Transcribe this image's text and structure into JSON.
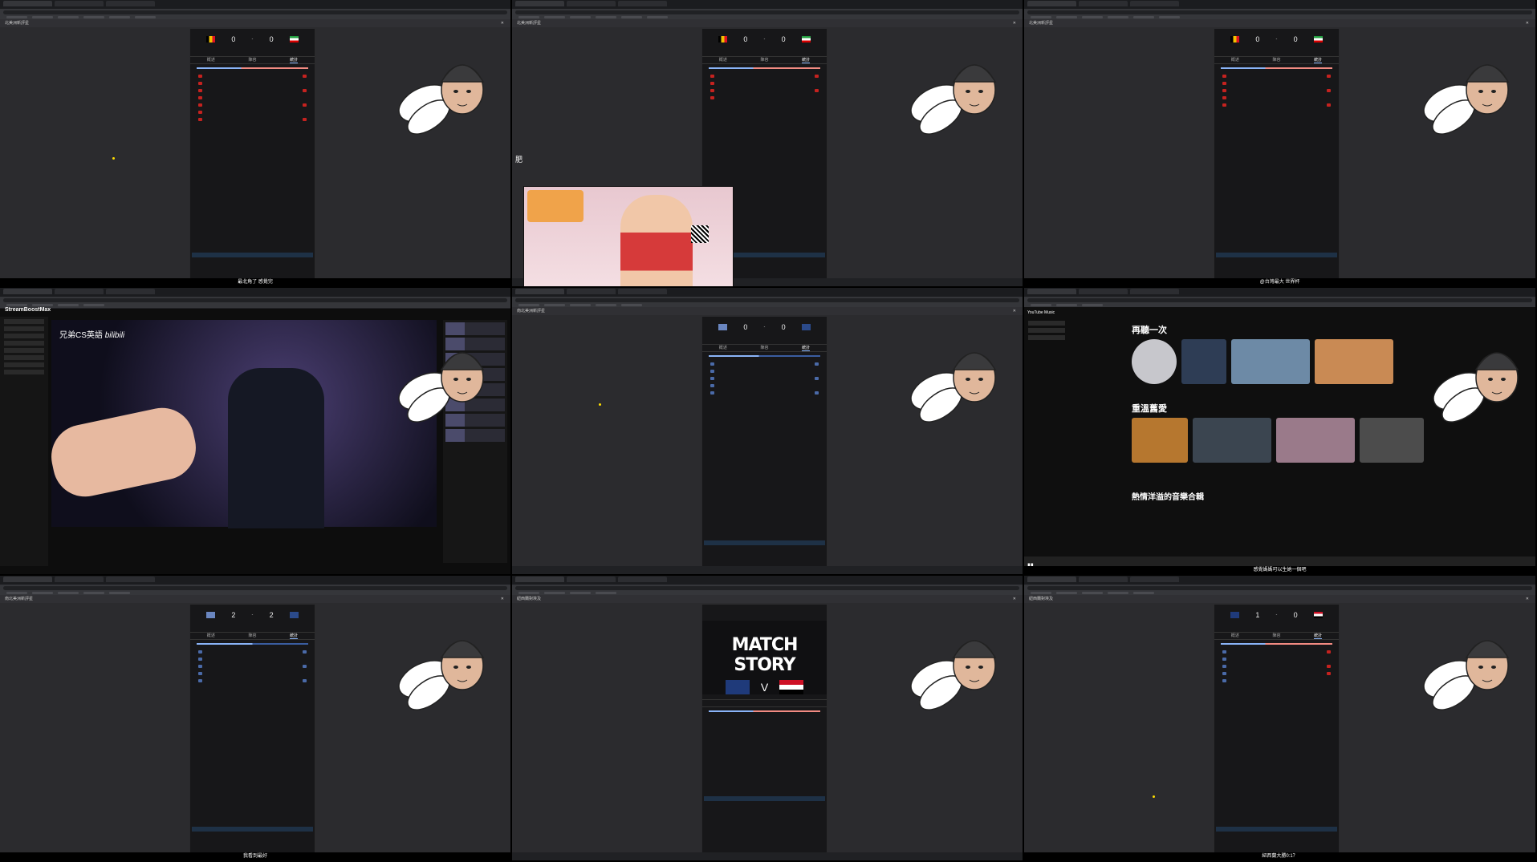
{
  "tiles": [
    {
      "id": "t1",
      "window_title": "北美洲新評星",
      "home_score": "0",
      "away_score": "0",
      "home_team": "比利時",
      "away_team": "伊朗",
      "tabs": [
        "概述",
        "陣容",
        "統計"
      ],
      "caption": "最北角了 感覺完"
    },
    {
      "id": "t2",
      "window_title": "北美洲新評星",
      "home_score": "0",
      "away_score": "0",
      "home_team": "比利時",
      "away_team": "伊朗",
      "tabs": [
        "概述",
        "陣容",
        "統計"
      ],
      "stream_overlay_tag": "肥",
      "caption": ""
    },
    {
      "id": "t3",
      "window_title": "北美洲新評星",
      "home_score": "0",
      "away_score": "0",
      "home_team": "比利時",
      "away_team": "伊朗",
      "tabs": [
        "概述",
        "陣容",
        "統計"
      ],
      "caption": "@台灣最大 世界杯"
    },
    {
      "id": "t4",
      "app": "StreamBoostMax",
      "video_label": "兄弟CS英語",
      "video_logo": "bilibili"
    },
    {
      "id": "t5",
      "window_title": "南北美洲新評星",
      "home_score": "0",
      "away_score": "0",
      "tabs": [
        "概述",
        "陣容",
        "統計"
      ]
    },
    {
      "id": "t6",
      "app": "YouTube Music",
      "section1": "再聽一次",
      "section2": "重溫舊愛",
      "section3": "熱情洋溢的音樂合輯",
      "caption": "感覺媽媽可以生她一個吧"
    },
    {
      "id": "t7",
      "window_title": "南北美洲新評星",
      "home_score": "2",
      "away_score": "2",
      "tabs": [
        "概述",
        "陣容",
        "統計"
      ],
      "caption": "我看到最好"
    },
    {
      "id": "t8",
      "window_title": "紐西蘭對埃及",
      "story_title": "MATCH STORY",
      "story_vs": "V"
    },
    {
      "id": "t9",
      "window_title": "紐西蘭對埃及",
      "home_score": "1",
      "away_score": "0",
      "tabs": [
        "概述",
        "陣容",
        "統計"
      ],
      "caption": "紐西蘭大勝0:1？"
    }
  ],
  "colors": {
    "accent": "#8ab4f8",
    "red": "#c5221f",
    "blue": "#4a6aa8"
  }
}
